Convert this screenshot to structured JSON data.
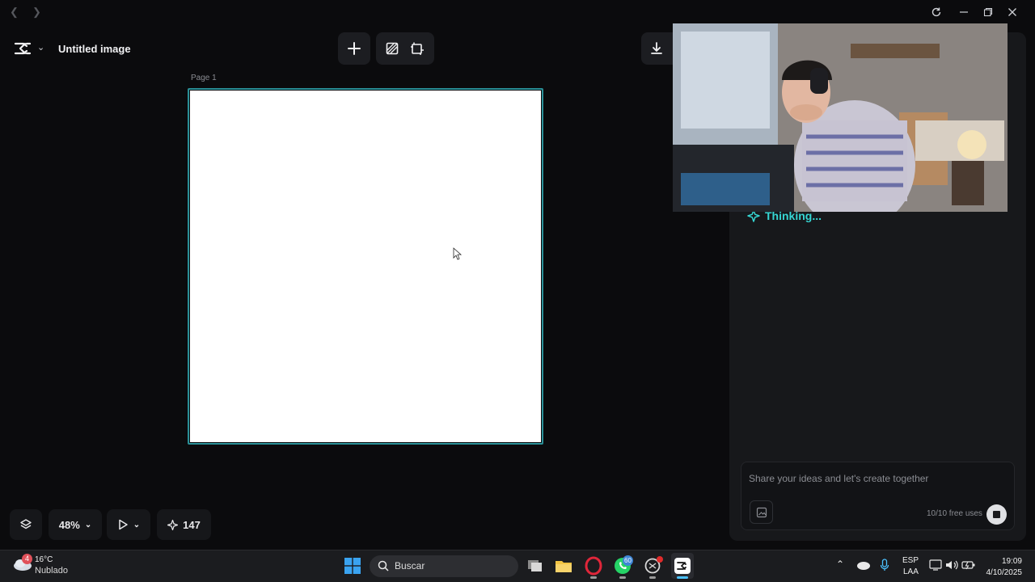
{
  "app": {
    "doc_title": "Untitled image",
    "page_label": "Page 1"
  },
  "bottom_controls": {
    "zoom": "48%",
    "credits": "147"
  },
  "assistant": {
    "status": "Thinking...",
    "prompt_placeholder": "Share your ideas and let's create together",
    "free_uses": "10/10 free uses"
  },
  "taskbar": {
    "weather_temp": "16°C",
    "weather_desc": "Nublado",
    "weather_badge": "4",
    "search_placeholder": "Buscar",
    "whatsapp_badge": "60",
    "lang_line1": "ESP",
    "lang_line2": "LAA",
    "time": "19:09",
    "date": "4/10/2025"
  },
  "colors": {
    "accent_teal": "#36d6d3",
    "selection_border": "#2a8f96",
    "background": "#0b0b0d",
    "panel": "#17181b"
  },
  "icons": [
    "back-arrow-icon",
    "forward-arrow-icon",
    "refresh-icon",
    "minimize-icon",
    "maximize-icon",
    "close-icon",
    "capcut-logo-icon",
    "add-icon",
    "remove-background-icon",
    "resize-icon",
    "download-icon",
    "layers-icon",
    "pointer-icon",
    "sparkle-icon",
    "attach-image-icon",
    "stop-icon",
    "search-icon",
    "windows-start-icon"
  ]
}
